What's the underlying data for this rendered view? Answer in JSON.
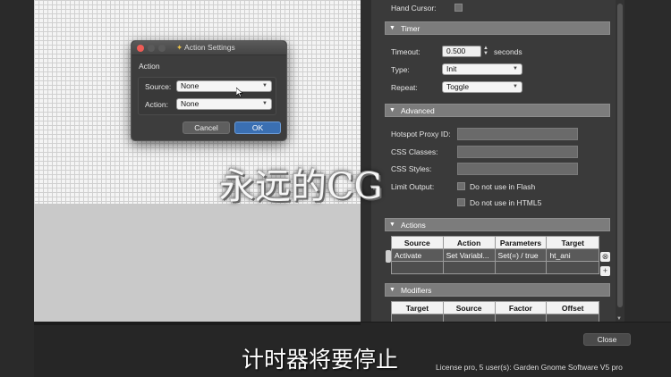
{
  "dialog": {
    "title": "Action Settings",
    "heading": "Action",
    "source_label": "Source:",
    "source_value": "None",
    "action_label": "Action:",
    "action_value": "None",
    "cancel_label": "Cancel",
    "ok_label": "OK"
  },
  "panel": {
    "hand_cursor_label": "Hand Cursor:",
    "timer": {
      "section_label": "Timer",
      "timeout_label": "Timeout:",
      "timeout_value": "0.500",
      "timeout_unit": "seconds",
      "type_label": "Type:",
      "type_value": "Init",
      "repeat_label": "Repeat:",
      "repeat_value": "Toggle"
    },
    "advanced": {
      "section_label": "Advanced",
      "proxy_label": "Hotspot Proxy ID:",
      "css_classes_label": "CSS Classes:",
      "css_styles_label": "CSS Styles:",
      "limit_output_label": "Limit Output:",
      "flash_label": "Do not use in Flash",
      "html5_label": "Do not use in HTML5"
    },
    "actions": {
      "section_label": "Actions",
      "columns": [
        "Source",
        "Action",
        "Parameters",
        "Target"
      ],
      "rows": [
        [
          "Activate",
          "Set Variabl...",
          "Set(=) / true",
          "ht_ani"
        ]
      ]
    },
    "modifiers": {
      "section_label": "Modifiers",
      "columns": [
        "Target",
        "Source",
        "Factor",
        "Offset"
      ]
    }
  },
  "footer": {
    "close_label": "Close",
    "license_text": "License pro, 5 user(s): Garden Gnome Software V5 pro"
  },
  "overlay": {
    "watermark": "永远的CG",
    "subtitle": "计时器将要停止"
  },
  "colors": {
    "ok_button": "#3a6fb2",
    "section_header": "#7c7c7c",
    "close_dot": "#ee5c56",
    "min_dot": "#5a5a5a"
  }
}
